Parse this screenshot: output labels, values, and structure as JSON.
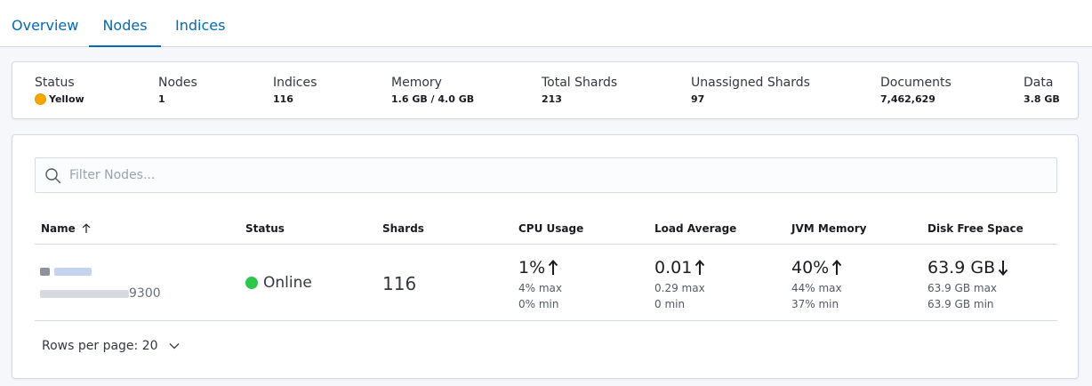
{
  "tabs": [
    {
      "label": "Overview"
    },
    {
      "label": "Nodes"
    },
    {
      "label": "Indices"
    }
  ],
  "summary": {
    "status": {
      "label": "Status",
      "value": "Yellow",
      "color": "#f5a700"
    },
    "nodes": {
      "label": "Nodes",
      "value": "1"
    },
    "indices": {
      "label": "Indices",
      "value": "116"
    },
    "memory": {
      "label": "Memory",
      "value": "1.6 GB / 4.0 GB"
    },
    "total_shards": {
      "label": "Total Shards",
      "value": "213"
    },
    "unassigned_shards": {
      "label": "Unassigned Shards",
      "value": "97"
    },
    "documents": {
      "label": "Documents",
      "value": "7,462,629"
    },
    "data": {
      "label": "Data",
      "value": "3.8 GB"
    }
  },
  "filter": {
    "placeholder": "Filter Nodes..."
  },
  "table": {
    "columns": [
      "Name",
      "Status",
      "Shards",
      "CPU Usage",
      "Load Average",
      "JVM Memory",
      "Disk Free Space"
    ],
    "rows": [
      {
        "name_suffix": "",
        "address_suffix": "9300",
        "status": "Online",
        "status_color": "#2fc74b",
        "shards": "116",
        "cpu": {
          "value": "1%",
          "trend": "up",
          "max": "4% max",
          "min": "0% min"
        },
        "load": {
          "value": "0.01",
          "trend": "up",
          "max": "0.29 max",
          "min": "0 min"
        },
        "jvm": {
          "value": "40%",
          "trend": "up",
          "max": "44% max",
          "min": "37% min"
        },
        "disk": {
          "value": "63.9 GB",
          "trend": "down",
          "max": "63.9 GB max",
          "min": "63.9 GB min"
        }
      }
    ]
  },
  "pagination": {
    "rows_per_page": "Rows per page: 20"
  }
}
